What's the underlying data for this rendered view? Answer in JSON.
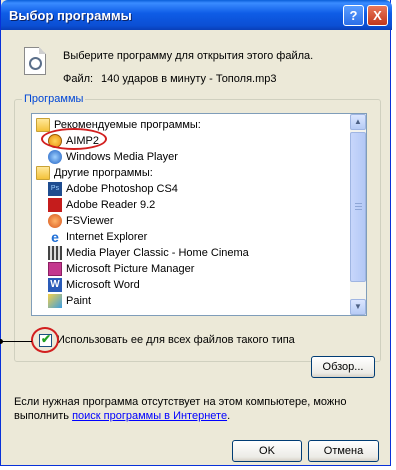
{
  "window": {
    "title": "Выбор программы",
    "help_button": "?",
    "close_button": "X"
  },
  "header": {
    "prompt": "Выберите программу для открытия этого файла.",
    "file_label": "Файл:",
    "file_name": "140 ударов в минуту - Тополя.mp3"
  },
  "programs_group": {
    "legend": "Программы",
    "items": [
      {
        "label": "Рекомендуемые программы:",
        "icon": "folder-icon",
        "indent": 0
      },
      {
        "label": "AIMP2",
        "icon": "aimp-icon",
        "indent": 1
      },
      {
        "label": "Windows Media Player",
        "icon": "windows-media-player-icon",
        "indent": 1
      },
      {
        "label": "Другие программы:",
        "icon": "folder-icon",
        "indent": 0
      },
      {
        "label": "Adobe Photoshop CS4",
        "icon": "photoshop-icon",
        "indent": 1
      },
      {
        "label": "Adobe Reader 9.2",
        "icon": "adobe-reader-icon",
        "indent": 1
      },
      {
        "label": "FSViewer",
        "icon": "fsviewer-icon",
        "indent": 1
      },
      {
        "label": "Internet Explorer",
        "icon": "internet-explorer-icon",
        "indent": 1
      },
      {
        "label": "Media Player Classic - Home Cinema",
        "icon": "media-player-classic-icon",
        "indent": 1
      },
      {
        "label": "Microsoft Picture Manager",
        "icon": "picture-manager-icon",
        "indent": 1
      },
      {
        "label": "Microsoft Word",
        "icon": "word-icon",
        "indent": 1
      },
      {
        "label": "Paint",
        "icon": "paint-icon",
        "indent": 1
      }
    ],
    "checkbox_label": "Использовать ее для всех файлов такого типа",
    "checkbox_checked": true,
    "browse_button": "Обзор..."
  },
  "footer": {
    "line1": "Если нужная программа отсутствует на этом компьютере, можно",
    "line2_prefix": "выполнить",
    "link": "поиск программы в Интернете",
    "line2_suffix": "."
  },
  "buttons": {
    "ok": "OK",
    "cancel": "Отмена"
  },
  "colors": {
    "title_bar": "#0b4fd4",
    "highlight_ring": "#d21f1f",
    "link": "#0000ff"
  }
}
